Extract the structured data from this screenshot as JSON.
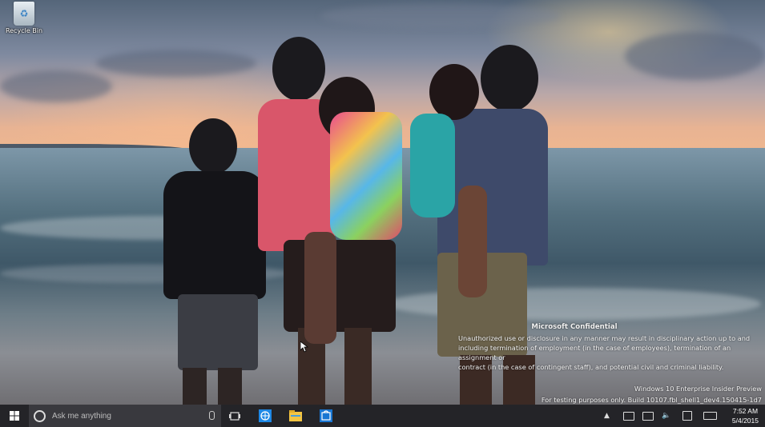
{
  "desktop": {
    "icons": [
      {
        "label": "Recycle Bin",
        "icon": "recycle-bin-icon"
      }
    ]
  },
  "watermark": {
    "title": "Microsoft Confidential",
    "body_lines": [
      "Unauthorized use or disclosure in any manner may result in disciplinary action up to and",
      "including termination of employment (in the case of employees), termination of an assignment or",
      "contract (in the case of contingent staff), and potential civil and criminal liability."
    ],
    "edition": "Windows 10 Enterprise Insider Preview",
    "build": "For testing purposes only. Build 10107.fbl_shell1_dev4.150415-1d7"
  },
  "taskbar": {
    "search_placeholder": "Ask me anything",
    "pinned": [
      {
        "name": "task-view-icon"
      },
      {
        "name": "browser-icon",
        "color": "#1e88e5"
      },
      {
        "name": "file-explorer-icon",
        "color": "#f4c542"
      },
      {
        "name": "store-icon",
        "color": "#1976d2"
      }
    ],
    "clock": {
      "time": "7:52 AM",
      "date": "5/4/2015"
    }
  }
}
